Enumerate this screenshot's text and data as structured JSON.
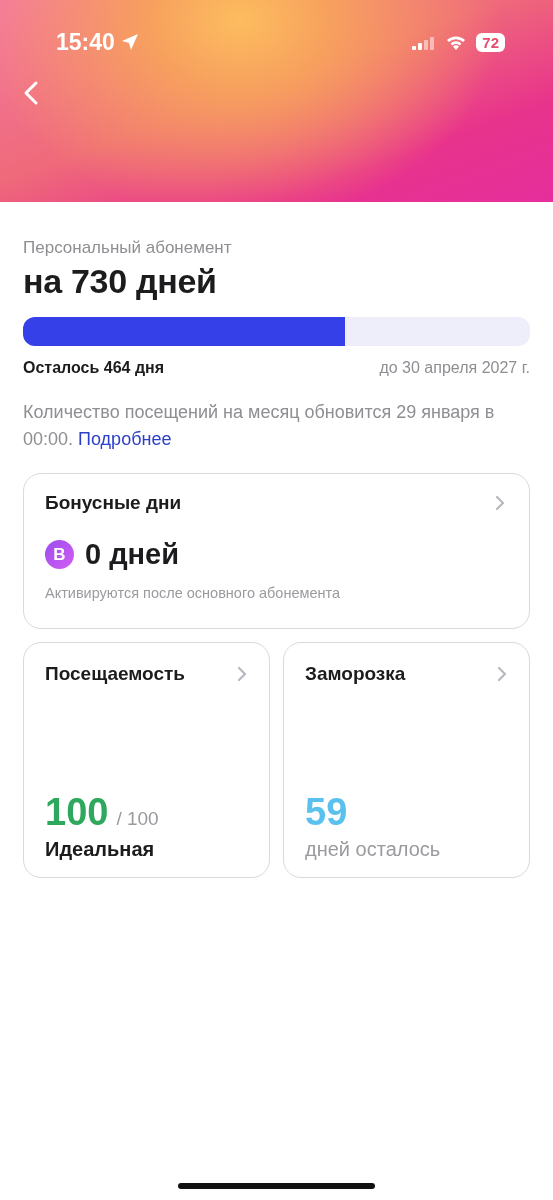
{
  "status_bar": {
    "time": "15:40",
    "battery": "72"
  },
  "subscription": {
    "caption": "Персональный абонемент",
    "title": "на 730 дней",
    "level": 0.636,
    "remaining": "Осталось 464 дня",
    "until": "до 30 апреля 2027 г.",
    "note": "Количество посещений на месяц обновится 29 января в 00:00.",
    "link": "Подробнее"
  },
  "bonus_card": {
    "title": "Бонусные дни",
    "badge": "B",
    "value": "0 дней",
    "hint": "Активируются после основного абонемента"
  },
  "tiles": [
    {
      "kind": "score",
      "title": "Посещаемость",
      "value": "100",
      "total": "/ 100",
      "caption": "Идеальная",
      "color": "#2ea85c"
    },
    {
      "kind": "count",
      "title": "Заморозка",
      "value": "59",
      "caption": "дней осталось",
      "color": "#5ac1ef"
    }
  ]
}
